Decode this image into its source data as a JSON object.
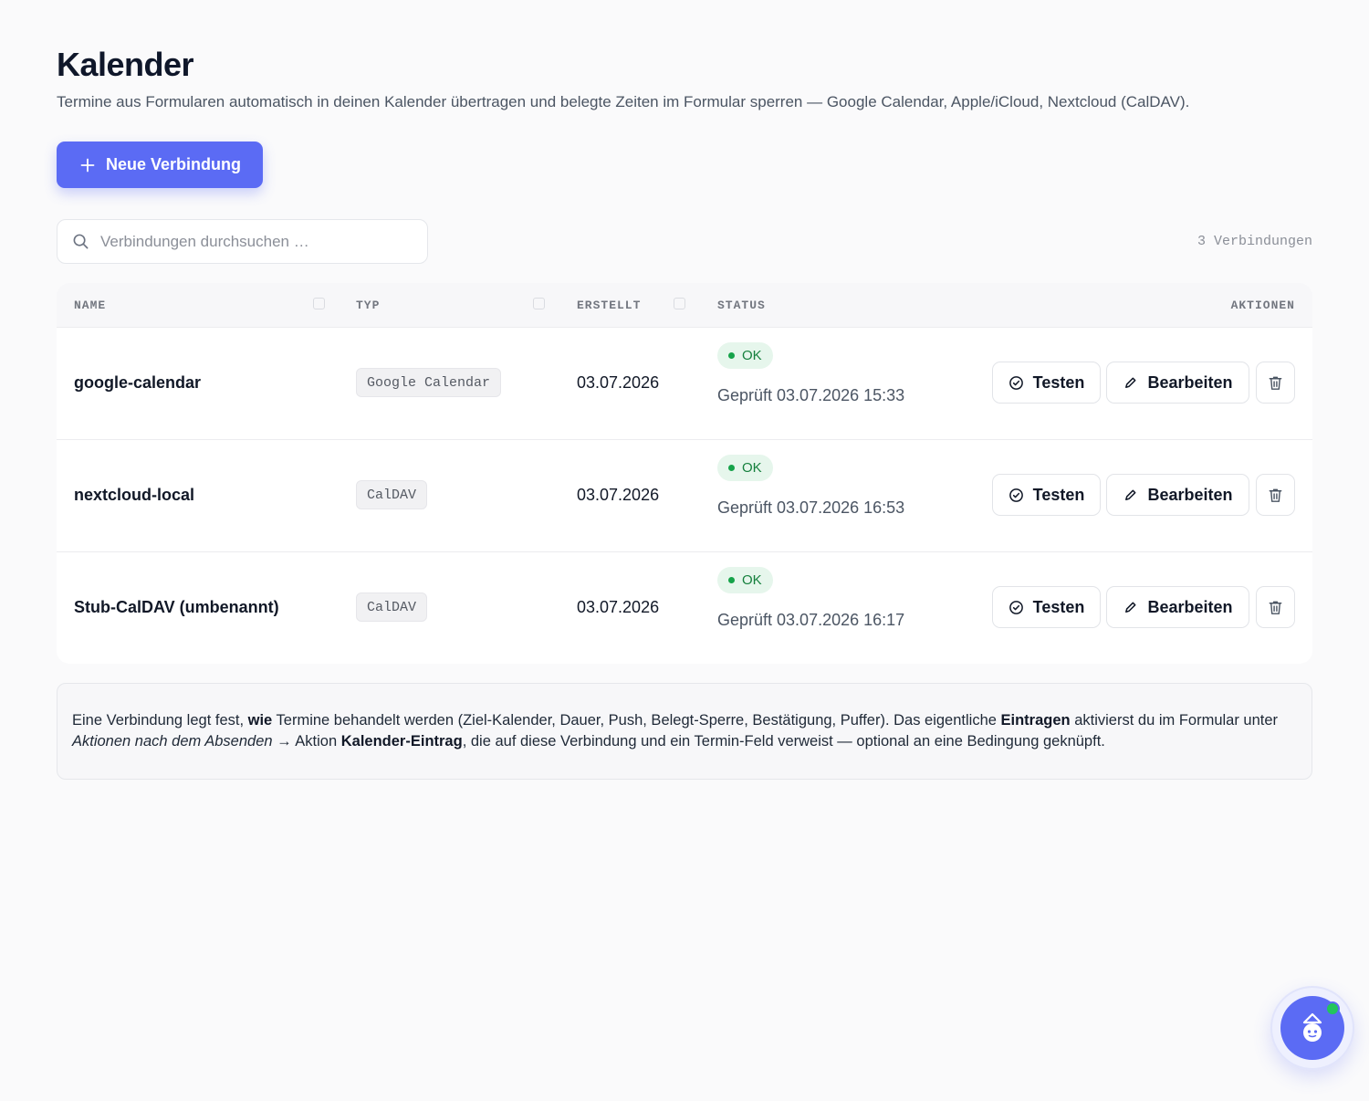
{
  "header": {
    "title": "Kalender",
    "subtitle": "Termine aus Formularen automatisch in deinen Kalender übertragen und belegte Zeiten im Formular sperren — Google Calendar, Apple/iCloud, Nextcloud (CalDAV)."
  },
  "toolbar": {
    "new_button_label": "Neue Verbindung",
    "search_placeholder": "Verbindungen durchsuchen …",
    "count_label": "3 Verbindungen"
  },
  "table": {
    "columns": {
      "name": "NAME",
      "type": "TYP",
      "created": "ERSTELLT",
      "status": "STATUS",
      "actions": "AKTIONEN"
    },
    "rows": [
      {
        "name": "google-calendar",
        "type": "Google Calendar",
        "created": "03.07.2026",
        "status": "OK",
        "checked": "Geprüft 03.07.2026 15:33"
      },
      {
        "name": "nextcloud-local",
        "type": "CalDAV",
        "created": "03.07.2026",
        "status": "OK",
        "checked": "Geprüft 03.07.2026 16:53"
      },
      {
        "name": "Stub-CalDAV (umbenannt)",
        "type": "CalDAV",
        "created": "03.07.2026",
        "status": "OK",
        "checked": "Geprüft 03.07.2026 16:17"
      }
    ],
    "actions": {
      "test_label": "Testen",
      "edit_label": "Bearbeiten"
    }
  },
  "info": {
    "p1": "Eine Verbindung legt fest, ",
    "b1": "wie",
    "p2": " Termine behandelt werden (Ziel-Kalender, Dauer, Push, Belegt-Sperre, Bestätigung, Puffer). Das eigentliche ",
    "b2": "Eintragen",
    "p3": " aktivierst du im Formular unter ",
    "i1": "Aktionen nach dem Absenden",
    "p4": " → Aktion ",
    "b3": "Kalender-Eintrag",
    "p5": ", die auf diese Verbindung und ein Termin-Feld verweist — optional an eine Bedingung geknüpft."
  },
  "icons": {
    "new": "plus-icon",
    "search": "search-icon",
    "test": "check-circle-icon",
    "edit": "pencil-icon",
    "delete": "trash-icon",
    "assistant": "robot-assistant-icon"
  },
  "colors": {
    "accent": "#5b6bf4",
    "status_ok_bg": "#e6f6ec",
    "status_ok_text": "#15803d",
    "online": "#22c55e"
  }
}
